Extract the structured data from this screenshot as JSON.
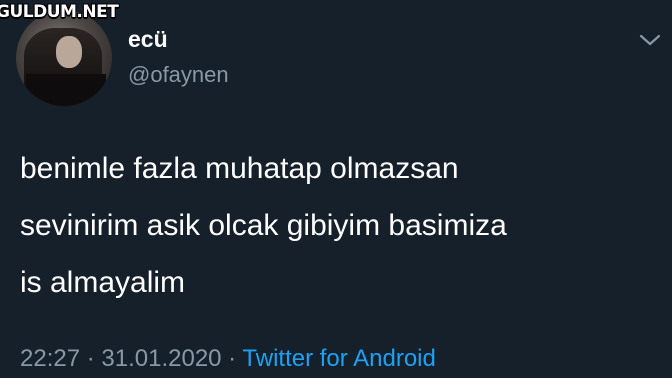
{
  "watermark": {
    "text": "GULDUM.NET"
  },
  "author": {
    "display_name": "ecü",
    "handle": "@ofaynen"
  },
  "tweet": {
    "lines": [
      "benimle fazla muhatap olmazsan",
      "sevinirim asik olcak gibiyim basimiza",
      "is almayalim"
    ],
    "time": "22:27",
    "separator1": " · ",
    "date": "31.01.2020",
    "separator2": " · ",
    "source": "Twitter for Android"
  },
  "icons": {
    "menu": "chevron-down-icon",
    "avatar": "profile-photo"
  },
  "colors": {
    "background": "#15202b",
    "secondary_text": "#8899a6",
    "link": "#1da1f2"
  }
}
